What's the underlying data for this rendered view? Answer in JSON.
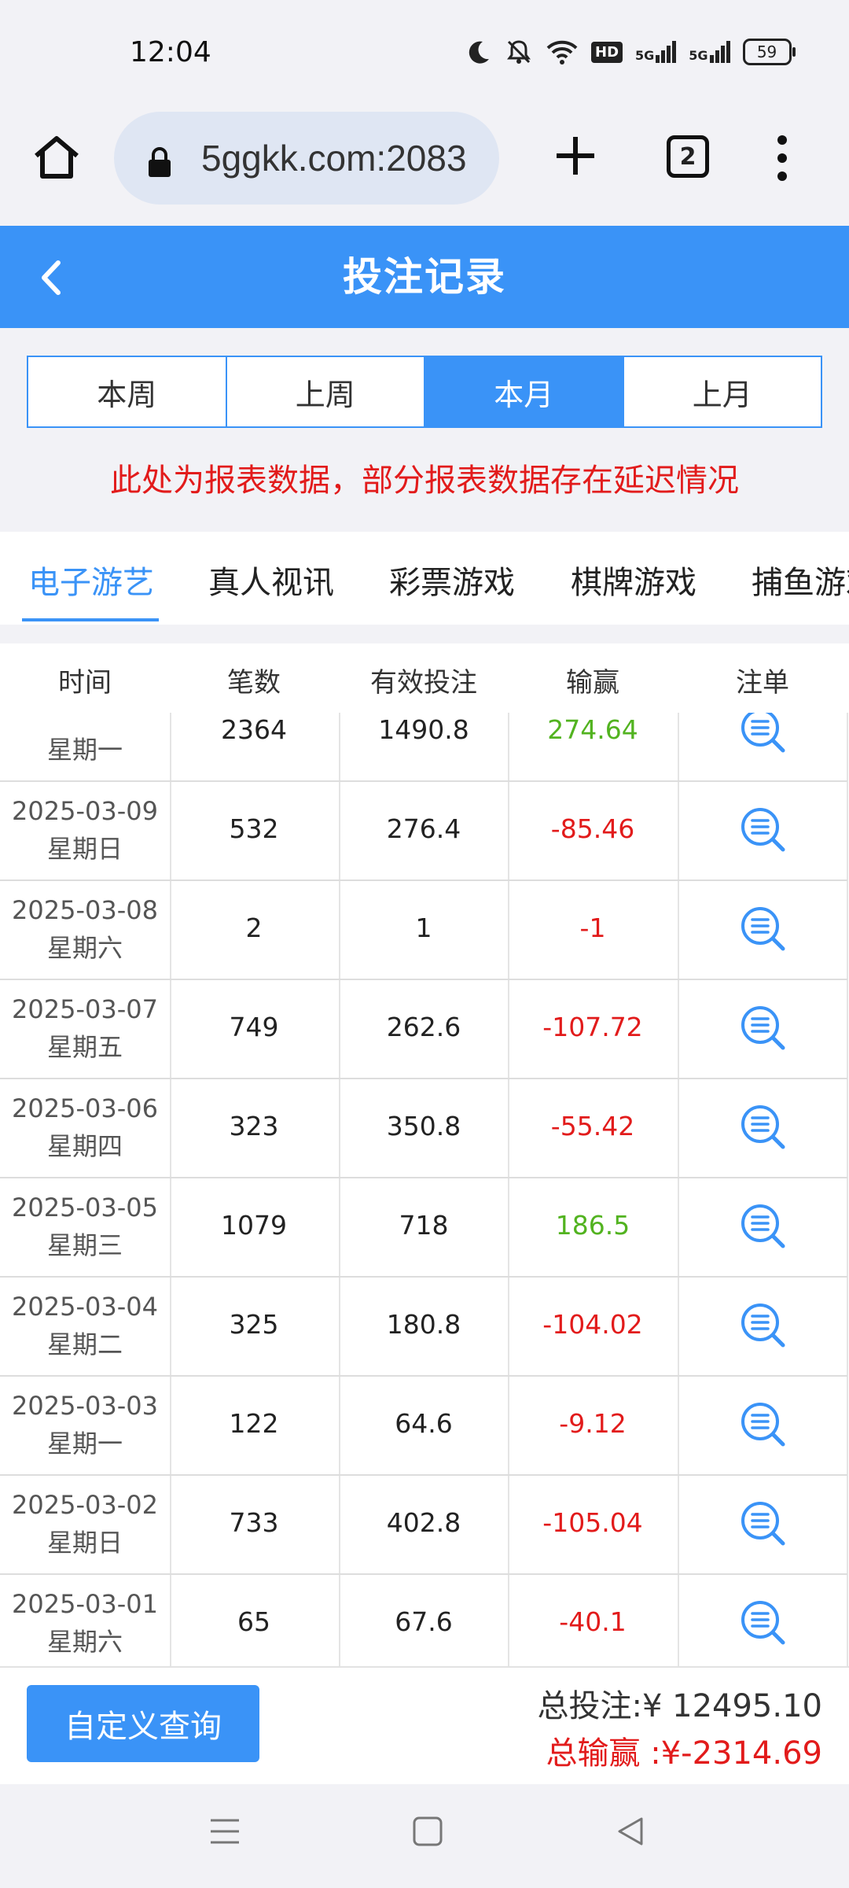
{
  "status_bar": {
    "time": "12:04",
    "battery": "59",
    "net1": "5G",
    "net2": "5G",
    "hd": "HD"
  },
  "browser": {
    "url": "5ggkk.com:2083",
    "tab_count": "2"
  },
  "header": {
    "title": "投注记录"
  },
  "period_tabs": [
    {
      "label": "本周",
      "active": false
    },
    {
      "label": "上周",
      "active": false
    },
    {
      "label": "本月",
      "active": true
    },
    {
      "label": "上月",
      "active": false
    }
  ],
  "notice": "此处为报表数据，部分报表数据存在延迟情况",
  "category_tabs": [
    "电子游艺",
    "真人视讯",
    "彩票游戏",
    "棋牌游戏",
    "捕鱼游戏"
  ],
  "table": {
    "columns": [
      "时间",
      "笔数",
      "有效投注",
      "输赢",
      "注单"
    ],
    "rows": [
      {
        "date": "",
        "weekday": "星期一",
        "count": "2364",
        "valid_bet": "1490.8",
        "win_loss": "274.64"
      },
      {
        "date": "2025-03-09",
        "weekday": "星期日",
        "count": "532",
        "valid_bet": "276.4",
        "win_loss": "-85.46"
      },
      {
        "date": "2025-03-08",
        "weekday": "星期六",
        "count": "2",
        "valid_bet": "1",
        "win_loss": "-1"
      },
      {
        "date": "2025-03-07",
        "weekday": "星期五",
        "count": "749",
        "valid_bet": "262.6",
        "win_loss": "-107.72"
      },
      {
        "date": "2025-03-06",
        "weekday": "星期四",
        "count": "323",
        "valid_bet": "350.8",
        "win_loss": "-55.42"
      },
      {
        "date": "2025-03-05",
        "weekday": "星期三",
        "count": "1079",
        "valid_bet": "718",
        "win_loss": "186.5"
      },
      {
        "date": "2025-03-04",
        "weekday": "星期二",
        "count": "325",
        "valid_bet": "180.8",
        "win_loss": "-104.02"
      },
      {
        "date": "2025-03-03",
        "weekday": "星期一",
        "count": "122",
        "valid_bet": "64.6",
        "win_loss": "-9.12"
      },
      {
        "date": "2025-03-02",
        "weekday": "星期日",
        "count": "733",
        "valid_bet": "402.8",
        "win_loss": "-105.04"
      },
      {
        "date": "2025-03-01",
        "weekday": "星期六",
        "count": "65",
        "valid_bet": "67.6",
        "win_loss": "-40.1"
      }
    ]
  },
  "footer": {
    "custom_query_label": "自定义查询",
    "total_bet": "总投注:¥ 12495.10",
    "total_win": "总输赢 :¥-2314.69"
  },
  "colors": {
    "accent": "#3a93f7",
    "negative": "#e21b1b",
    "positive": "#52b320"
  }
}
